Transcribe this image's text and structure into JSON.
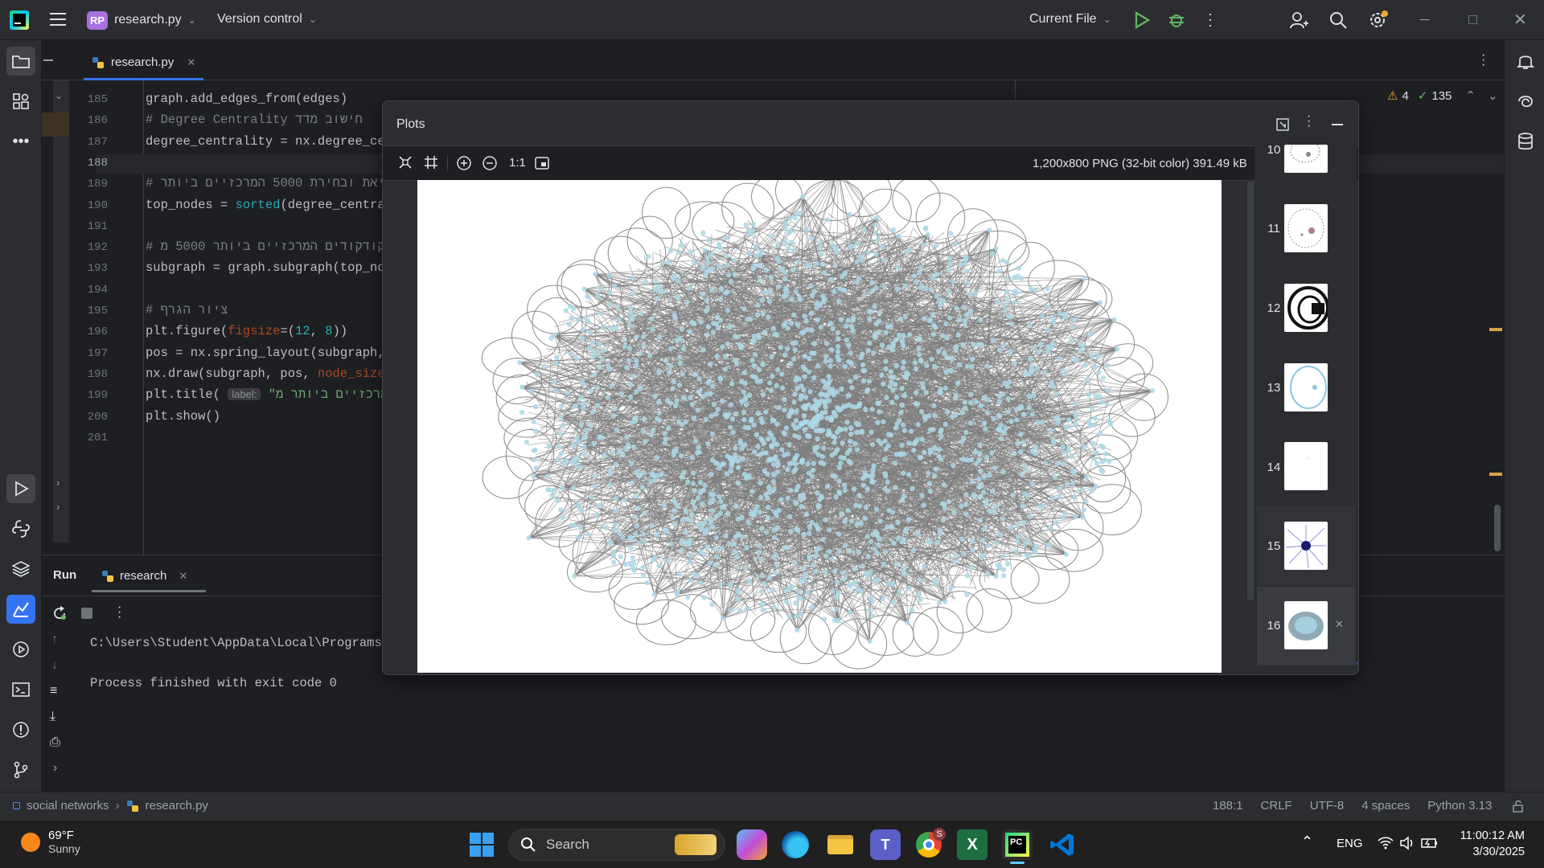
{
  "titlebar": {
    "project_badge": "RP",
    "project_name": "research.py",
    "vcs": "Version control",
    "run_config": "Current File"
  },
  "editor": {
    "tab_name": "research.py",
    "warnings": "4",
    "checks": "135",
    "lines": [
      {
        "n": "185",
        "html": "graph.add_edges_from(edges)"
      },
      {
        "n": "186",
        "html": "<span class='cm'># Degree Centrality חישוב מדד</span>"
      },
      {
        "n": "187",
        "html": "degree_centrality = nx.degree_cen"
      },
      {
        "n": "188",
        "html": ""
      },
      {
        "n": "189",
        "html": "<span class='cm'># מציאת ובחירת 5000 המרכזיים ביותר</span>"
      },
      {
        "n": "190",
        "html": "top_nodes = <span class='nm'>sorted</span>(degree_central"
      },
      {
        "n": "191",
        "html": ""
      },
      {
        "n": "192",
        "html": "<span class='cm'># הקודקודים המרכזיים ביותר 5000 מ</span>"
      },
      {
        "n": "193",
        "html": "subgraph = graph.subgraph(top_noc"
      },
      {
        "n": "194",
        "html": ""
      },
      {
        "n": "195",
        "html": "<span class='cm'># ציור הגרף</span>"
      },
      {
        "n": "196",
        "html": "plt.figure(<span class='pr'>figsize</span>=(<span class='nm'>12</span>, <span class='nm'>8</span>))"
      },
      {
        "n": "197",
        "html": "pos = nx.spring_layout(subgraph,"
      },
      {
        "n": "198",
        "html": "nx.draw(subgraph, pos, <span class='pr'>node_size</span>="
      },
      {
        "n": "199",
        "html": "plt.title( <span class='hint'>label:</span> <span class='st'>\"המרכזיים ביותר מ</span>"
      },
      {
        "n": "200",
        "html": "plt.show()"
      },
      {
        "n": "201",
        "html": ""
      }
    ]
  },
  "run": {
    "tab_label": "Run",
    "config_name": "research",
    "path_line": "C:\\Users\\Student\\AppData\\Local\\Programs\\",
    "exit_line": "Process finished with exit code 0"
  },
  "plots": {
    "title": "Plots",
    "zoom_label": "1:1",
    "image_info": "1,200x800 PNG (32-bit color) 391.49 kB",
    "thumbnails": [
      "10",
      "11",
      "12",
      "13",
      "14",
      "15",
      "16"
    ],
    "selected": "16"
  },
  "statusbar": {
    "project": "social networks",
    "file": "research.py",
    "position": "188:1",
    "line_sep": "CRLF",
    "encoding": "UTF-8",
    "indent": "4 spaces",
    "interpreter": "Python 3.13"
  },
  "taskbar": {
    "temp": "69°F",
    "weather": "Sunny",
    "search": "Search",
    "lang": "ENG",
    "time": "11:00:12 AM",
    "date": "3/30/2025",
    "chrome_badge": "S"
  }
}
